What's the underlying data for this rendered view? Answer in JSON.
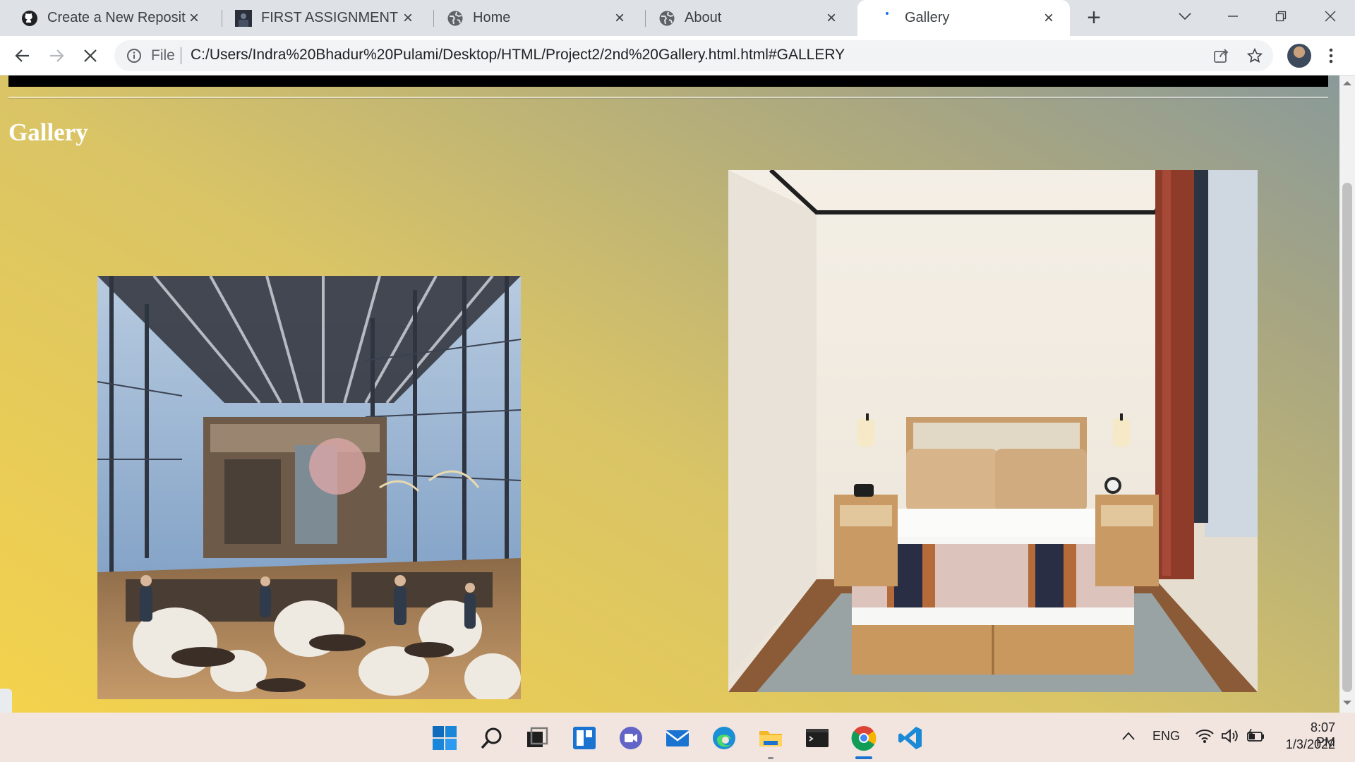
{
  "browser": {
    "tabs": [
      {
        "title": "Create a New Repository",
        "icon": "github-icon",
        "active": false
      },
      {
        "title": "FIRST ASSIGNMENT",
        "icon": "photo-thumbnail-icon",
        "active": false
      },
      {
        "title": "Home",
        "icon": "globe-icon",
        "active": false
      },
      {
        "title": "About",
        "icon": "globe-icon",
        "active": false
      },
      {
        "title": "Gallery",
        "icon": "loading-icon",
        "active": true
      }
    ],
    "address": {
      "scheme_label": "File",
      "url": "C:/Users/Indra%20Bhadur%20Pulami/Desktop/HTML/Project2/2nd%20Gallery.html.html#GALLERY"
    }
  },
  "page": {
    "heading": "Gallery",
    "images": [
      {
        "subject": "restaurant interior with tall windows",
        "icon": "restaurant-photo"
      },
      {
        "subject": "hotel bedroom with bed and nightstands",
        "icon": "bedroom-photo"
      }
    ],
    "colors": {
      "gradient_start": "#f4d24c",
      "gradient_end": "#8a9a99",
      "top_bar": "#000000"
    }
  },
  "taskbar": {
    "apps": [
      "windows-start-icon",
      "search-icon",
      "task-view-icon",
      "widgets-icon",
      "chat-icon",
      "mail-icon",
      "edge-icon",
      "file-explorer-icon",
      "terminal-icon",
      "chrome-icon",
      "vscode-icon"
    ],
    "tray": {
      "language": "ENG",
      "time": "8:07 PM",
      "date": "1/3/2022"
    }
  }
}
